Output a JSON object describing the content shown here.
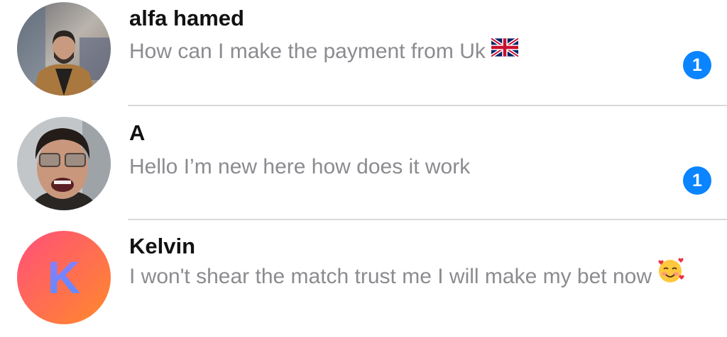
{
  "conversations": [
    {
      "name": "alfa hamed",
      "preview": "How can I make the payment from Uk",
      "flag_icon": "uk-flag-icon",
      "unread_count": "1",
      "avatar": "photo"
    },
    {
      "name": "A",
      "preview": "Hello I’m new here how does it work",
      "unread_count": "1",
      "avatar": "photo"
    },
    {
      "name": "Kelvin",
      "preview": "I won't shear the match trust me I will make my bet now",
      "emoji_icon": "smiling-face-with-hearts-icon",
      "avatar_letter": "K",
      "avatar_colors": [
        "#ff4f7b",
        "#ff8a2a"
      ]
    }
  ],
  "colors": {
    "badge": "#0a84ff",
    "name_text": "#111111",
    "preview_text": "#8b8b90",
    "divider": "#d9d9dd"
  }
}
